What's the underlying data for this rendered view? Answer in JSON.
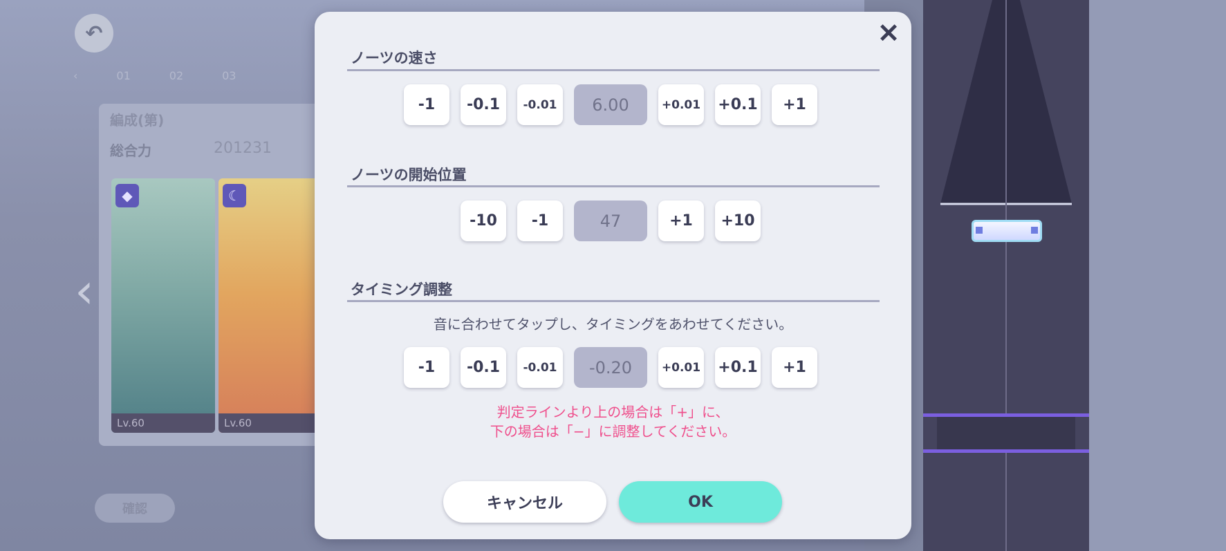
{
  "background": {
    "tabs": [
      "01",
      "02",
      "03"
    ],
    "team_title": "編成(第)",
    "team_power_label": "総合力",
    "team_power_value": "201231",
    "cards": [
      {
        "attr_icon": "◆",
        "level": "Lv.60"
      },
      {
        "attr_icon": "☾",
        "level": "Lv.60"
      }
    ],
    "bottom_button": "確認"
  },
  "dialog": {
    "close_icon": "✕",
    "note_speed": {
      "title": "ノーツの速さ",
      "buttons_minus": [
        "-1",
        "-0.1",
        "-0.01"
      ],
      "value": "6.00",
      "buttons_plus": [
        "+0.01",
        "+0.1",
        "+1"
      ]
    },
    "note_start": {
      "title": "ノーツの開始位置",
      "buttons_minus": [
        "-10",
        "-1"
      ],
      "value": "47",
      "buttons_plus": [
        "+1",
        "+10"
      ]
    },
    "timing": {
      "title": "タイミング調整",
      "description": "音に合わせてタップし、タイミングをあわせてください。",
      "buttons_minus": [
        "-1",
        "-0.1",
        "-0.01"
      ],
      "value": "-0.20",
      "buttons_plus": [
        "+0.01",
        "+0.1",
        "+1"
      ],
      "note_line1": "判定ラインより上の場合は「+」に、",
      "note_line2": "下の場合は「−」に調整してください。"
    },
    "cancel_label": "キャンセル",
    "ok_label": "OK"
  },
  "colors": {
    "accent_ok": "#6eeadb",
    "warning_text": "#ef4f8c",
    "value_box": "#b3b5cc"
  }
}
